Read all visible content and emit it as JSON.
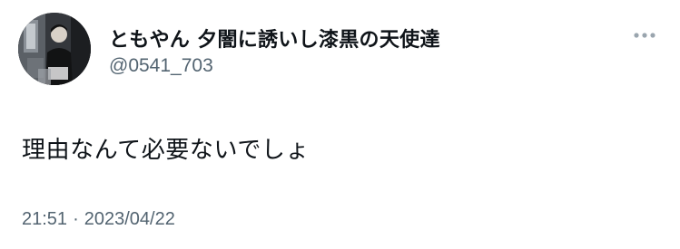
{
  "tweet": {
    "author": {
      "display_name": "ともやん 夕闇に誘いし漆黒の天使達",
      "handle": "@0541_703",
      "avatar_icon": "user-avatar-photo"
    },
    "text": "理由なんて必要ないでしょ",
    "time": "21:51",
    "separator": "·",
    "date": "2023/04/22",
    "more_icon": "more-options-icon"
  },
  "colors": {
    "text_primary": "#0f1419",
    "text_secondary": "#536471",
    "background": "#ffffff"
  }
}
